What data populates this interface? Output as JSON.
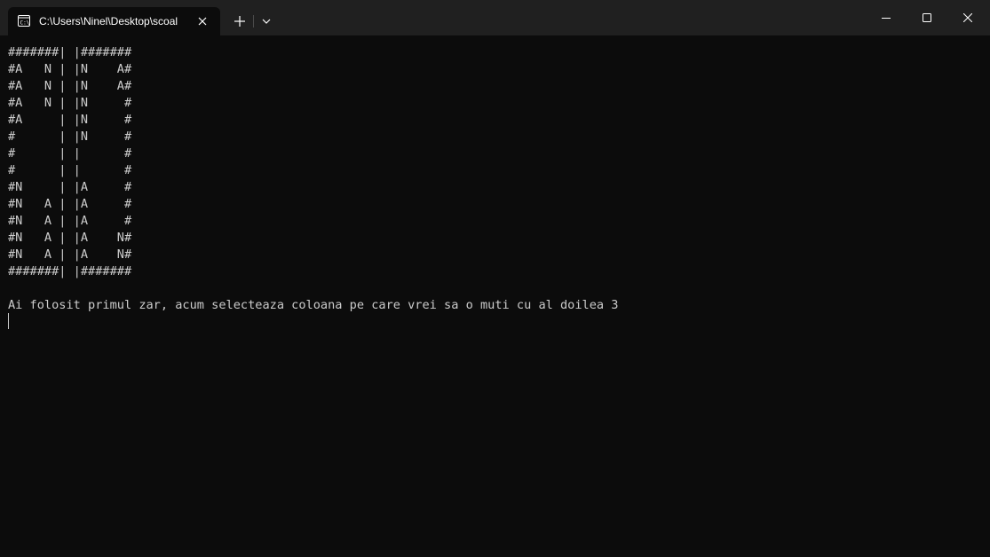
{
  "window": {
    "tab_title": "C:\\Users\\Ninel\\Desktop\\scoal",
    "tab_icon": "terminal-icon",
    "controls": [
      "minimize-icon",
      "maximize-icon",
      "close-icon"
    ]
  },
  "terminal": {
    "board": [
      "#######| |#######",
      "#A   N | |N    A#",
      "#A   N | |N    A#",
      "#A   N | |N     #",
      "#A     | |N     #",
      "#      | |N     #",
      "#      | |      #",
      "#      | |      #",
      "#N     | |A     #",
      "#N   A | |A     #",
      "#N   A | |A     #",
      "#N   A | |A    N#",
      "#N   A | |A    N#",
      "#######| |#######"
    ],
    "message": "Ai folosit primul zar, acum selecteaza coloana pe care vrei sa o muti cu al doilea 3",
    "colors": {
      "background": "#0c0c0c",
      "foreground": "#cccccc",
      "titlebar": "#202020"
    }
  }
}
